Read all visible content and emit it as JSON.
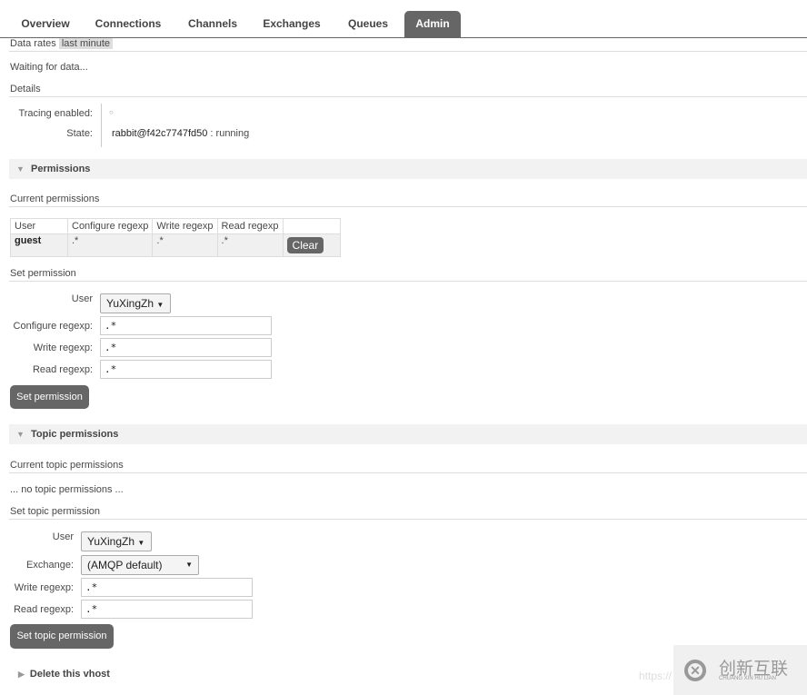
{
  "tabs": [
    "Overview",
    "Connections",
    "Channels",
    "Exchanges",
    "Queues",
    "Admin"
  ],
  "data_rates": {
    "label": "Data rates",
    "value": "last minute"
  },
  "waiting": "Waiting for data...",
  "details": {
    "title": "Details",
    "tracing_label": "Tracing enabled:",
    "tracing_value": "○",
    "state_label": "State:",
    "node": "rabbit@f42c7747fd50",
    "status": ": running"
  },
  "permissions": {
    "title": "Permissions",
    "current": "Current permissions",
    "headers": [
      "User",
      "Configure regexp",
      "Write regexp",
      "Read regexp"
    ],
    "rows": [
      {
        "user": "guest",
        "configure": ".*",
        "write": ".*",
        "read": ".*",
        "action": "Clear"
      }
    ],
    "set_title": "Set permission",
    "user_label": "User",
    "user_value": "YuXingZh",
    "configure_label": "Configure regexp:",
    "configure_value": ".*",
    "write_label": "Write regexp:",
    "write_value": ".*",
    "read_label": "Read regexp:",
    "read_value": ".*",
    "submit": "Set permission"
  },
  "topic": {
    "title": "Topic permissions",
    "current": "Current topic permissions",
    "none": "... no topic permissions ...",
    "set_title": "Set topic permission",
    "user_label": "User",
    "user_value": "YuXingZh",
    "exchange_label": "Exchange:",
    "exchange_value": "(AMQP default)",
    "write_label": "Write regexp:",
    "write_value": ".*",
    "read_label": "Read regexp:",
    "read_value": ".*",
    "submit": "Set topic permission"
  },
  "delete": "Delete this vhost",
  "watermark": {
    "url": "https://",
    "brand": "创新互联",
    "sub": "CHUANG XIN HU LIAN"
  }
}
